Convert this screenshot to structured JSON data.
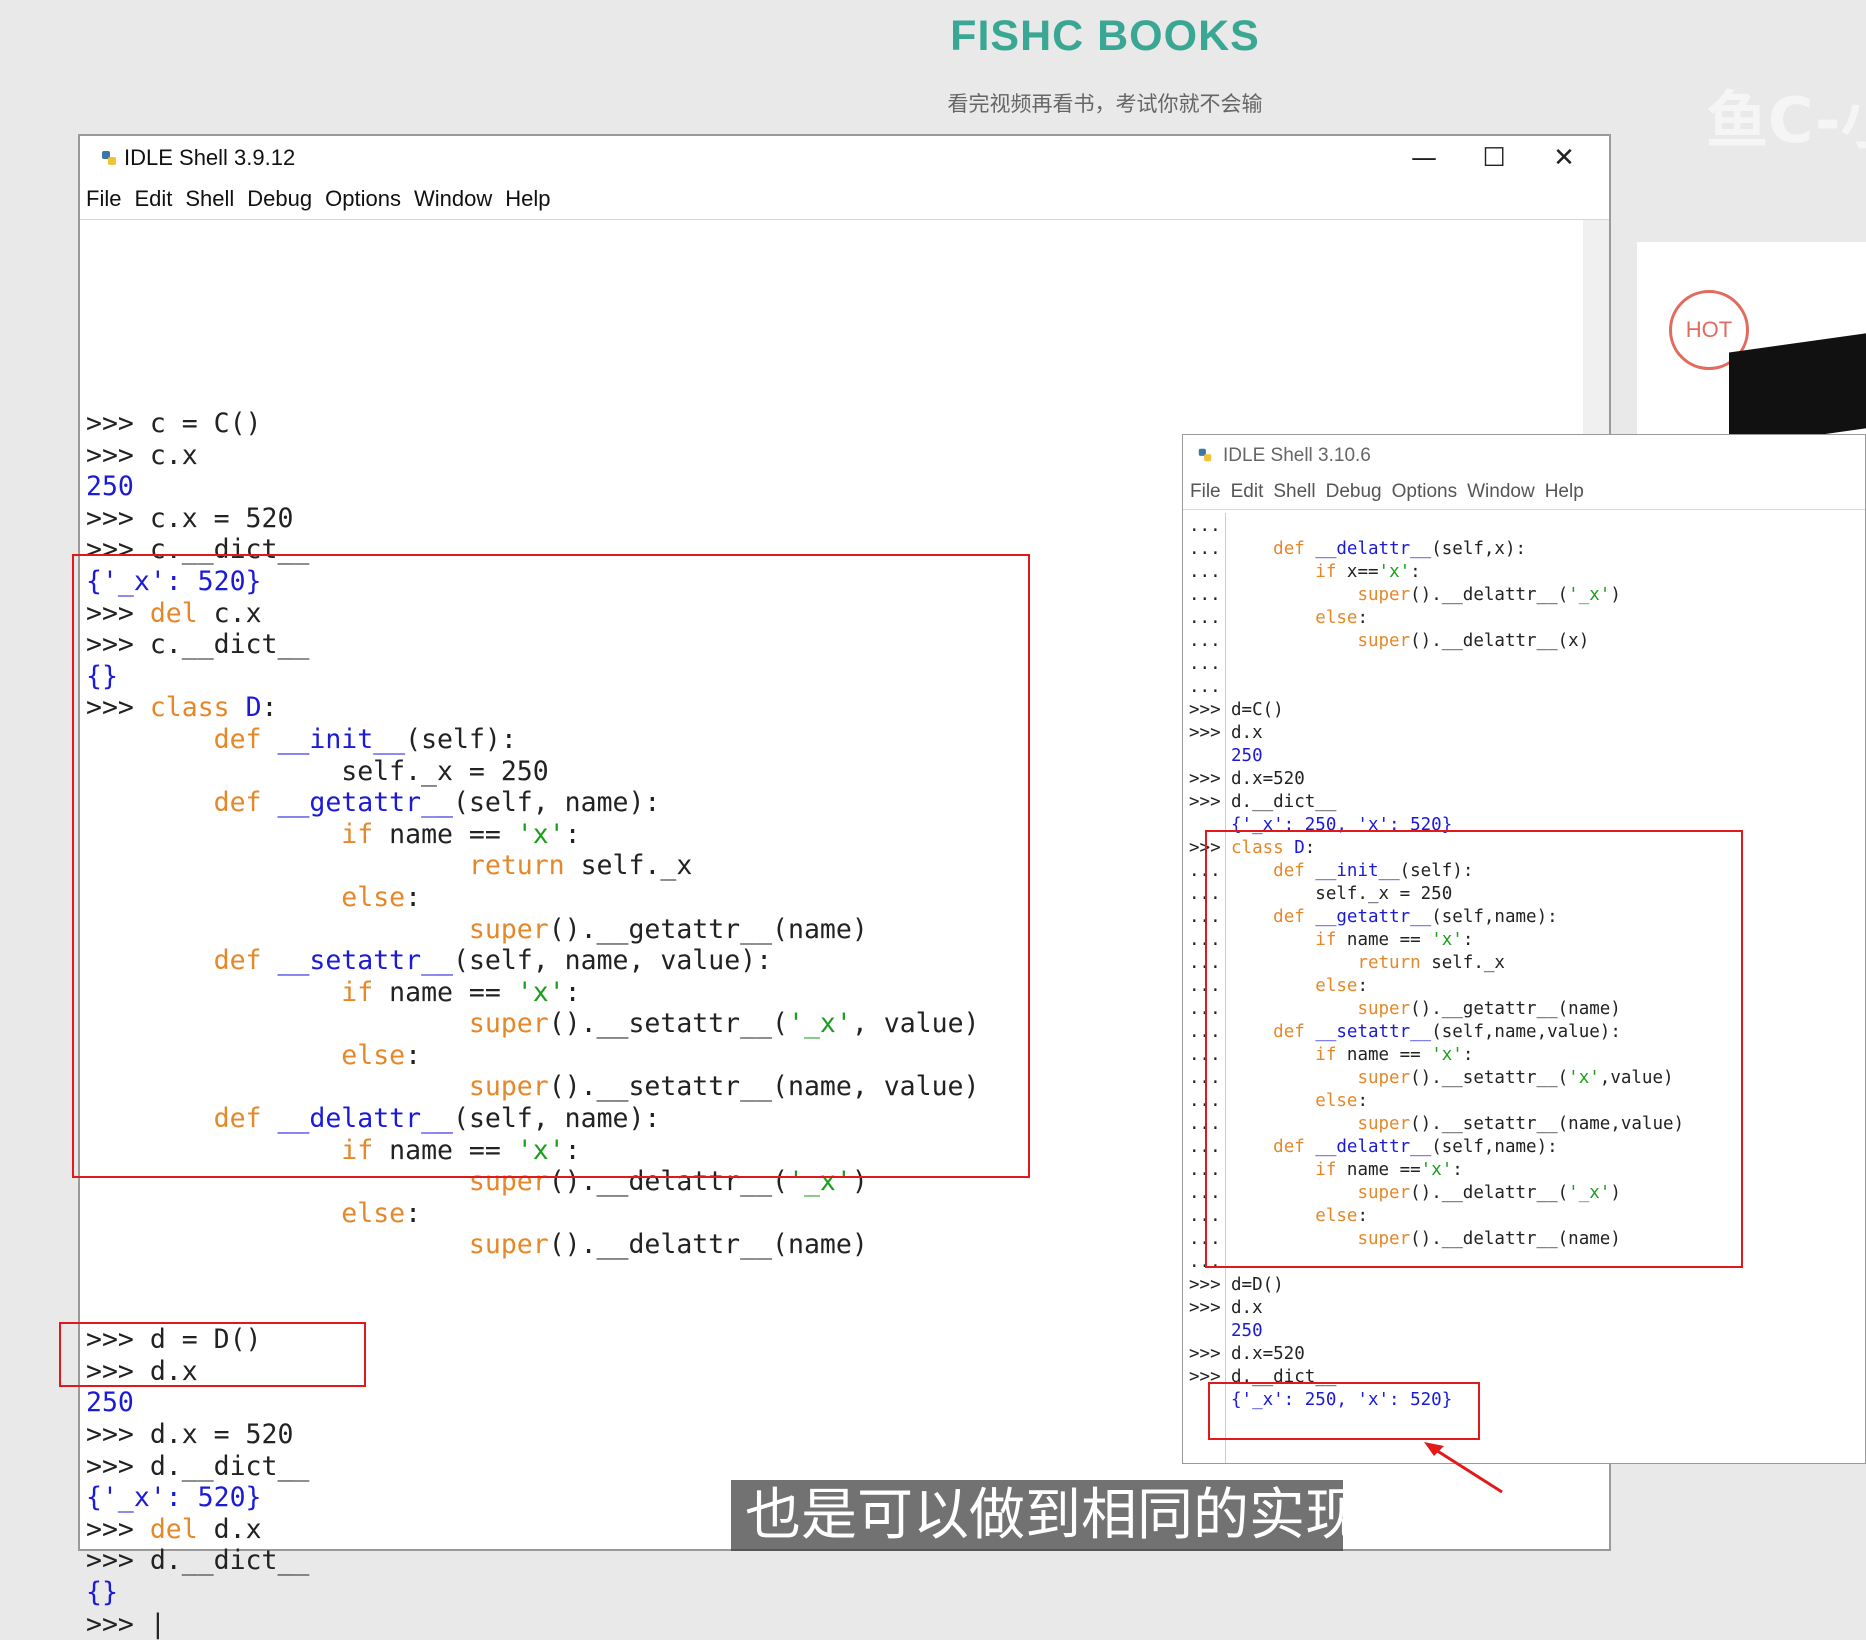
{
  "header": {
    "brand": "FISHC BOOKS",
    "slogan": "看完视频再看书，考试你就不会输",
    "watermark": "鱼C-小"
  },
  "promo": {
    "badge": "HOT"
  },
  "shell_left": {
    "title": "IDLE Shell 3.9.12",
    "menu": [
      "File",
      "Edit",
      "Shell",
      "Debug",
      "Options",
      "Window",
      "Help"
    ],
    "controls": {
      "minimize": "—",
      "maximize": "☐",
      "close": "✕"
    },
    "lines": [
      [
        [
          "p",
          ">>> "
        ],
        [
          "n",
          "c = C()"
        ]
      ],
      [
        [
          "p",
          ">>> "
        ],
        [
          "n",
          "c.x"
        ]
      ],
      [
        [
          "o",
          "250"
        ]
      ],
      [
        [
          "p",
          ">>> "
        ],
        [
          "n",
          "c.x = 520"
        ]
      ],
      [
        [
          "p",
          ">>> "
        ],
        [
          "n",
          "c.__dict__"
        ]
      ],
      [
        [
          "o",
          "{'_x': 520}"
        ]
      ],
      [
        [
          "p",
          ">>> "
        ],
        [
          "k",
          "del"
        ],
        [
          "n",
          " c.x"
        ]
      ],
      [
        [
          "p",
          ">>> "
        ],
        [
          "n",
          "c.__dict__"
        ]
      ],
      [
        [
          "o",
          "{}"
        ]
      ],
      [
        [
          "p",
          ">>> "
        ],
        [
          "k",
          "class"
        ],
        [
          "n",
          " "
        ],
        [
          "f",
          "D"
        ],
        [
          "n",
          ":"
        ]
      ],
      [
        [
          "n",
          "        "
        ],
        [
          "k",
          "def"
        ],
        [
          "n",
          " "
        ],
        [
          "f",
          "__init__"
        ],
        [
          "n",
          "(self):"
        ]
      ],
      [
        [
          "n",
          "                self._x = 250"
        ]
      ],
      [
        [
          "n",
          "        "
        ],
        [
          "k",
          "def"
        ],
        [
          "n",
          " "
        ],
        [
          "f",
          "__getattr__"
        ],
        [
          "n",
          "(self, name):"
        ]
      ],
      [
        [
          "n",
          "                "
        ],
        [
          "k",
          "if"
        ],
        [
          "n",
          " name == "
        ],
        [
          "s",
          "'x'"
        ],
        [
          "n",
          ":"
        ]
      ],
      [
        [
          "n",
          "                        "
        ],
        [
          "k",
          "return"
        ],
        [
          "n",
          " self._x"
        ]
      ],
      [
        [
          "n",
          "                "
        ],
        [
          "k",
          "else"
        ],
        [
          "n",
          ":"
        ]
      ],
      [
        [
          "n",
          "                        "
        ],
        [
          "k",
          "super"
        ],
        [
          "n",
          "().__getattr__(name)"
        ]
      ],
      [
        [
          "n",
          "        "
        ],
        [
          "k",
          "def"
        ],
        [
          "n",
          " "
        ],
        [
          "f",
          "__setattr__"
        ],
        [
          "n",
          "(self, name, value):"
        ]
      ],
      [
        [
          "n",
          "                "
        ],
        [
          "k",
          "if"
        ],
        [
          "n",
          " name == "
        ],
        [
          "s",
          "'x'"
        ],
        [
          "n",
          ":"
        ]
      ],
      [
        [
          "n",
          "                        "
        ],
        [
          "k",
          "super"
        ],
        [
          "n",
          "().__setattr__("
        ],
        [
          "s",
          "'_x'"
        ],
        [
          "n",
          ", value)"
        ]
      ],
      [
        [
          "n",
          "                "
        ],
        [
          "k",
          "else"
        ],
        [
          "n",
          ":"
        ]
      ],
      [
        [
          "n",
          "                        "
        ],
        [
          "k",
          "super"
        ],
        [
          "n",
          "().__setattr__(name, value)"
        ]
      ],
      [
        [
          "n",
          "        "
        ],
        [
          "k",
          "def"
        ],
        [
          "n",
          " "
        ],
        [
          "f",
          "__delattr__"
        ],
        [
          "n",
          "(self, name):"
        ]
      ],
      [
        [
          "n",
          "                "
        ],
        [
          "k",
          "if"
        ],
        [
          "n",
          " name == "
        ],
        [
          "s",
          "'x'"
        ],
        [
          "n",
          ":"
        ]
      ],
      [
        [
          "n",
          "                        "
        ],
        [
          "k",
          "super"
        ],
        [
          "n",
          "().__delattr__("
        ],
        [
          "s",
          "'_x'"
        ],
        [
          "n",
          ")"
        ]
      ],
      [
        [
          "n",
          "                "
        ],
        [
          "k",
          "else"
        ],
        [
          "n",
          ":"
        ]
      ],
      [
        [
          "n",
          "                        "
        ],
        [
          "k",
          "super"
        ],
        [
          "n",
          "().__delattr__(name)"
        ]
      ],
      [
        [
          "n",
          ""
        ]
      ],
      [
        [
          "n",
          ""
        ]
      ],
      [
        [
          "p",
          ">>> "
        ],
        [
          "n",
          "d = D()"
        ]
      ],
      [
        [
          "p",
          ">>> "
        ],
        [
          "n",
          "d.x"
        ]
      ],
      [
        [
          "o",
          "250"
        ]
      ],
      [
        [
          "p",
          ">>> "
        ],
        [
          "n",
          "d.x = 520"
        ]
      ],
      [
        [
          "p",
          ">>> "
        ],
        [
          "n",
          "d.__dict__"
        ]
      ],
      [
        [
          "o",
          "{'_x': 520}"
        ]
      ],
      [
        [
          "p",
          ">>> "
        ],
        [
          "k",
          "del"
        ],
        [
          "n",
          " d.x"
        ]
      ],
      [
        [
          "p",
          ">>> "
        ],
        [
          "n",
          "d.__dict__"
        ]
      ],
      [
        [
          "o",
          "{}"
        ]
      ],
      [
        [
          "p",
          ">>> "
        ],
        [
          "n",
          "|"
        ]
      ]
    ]
  },
  "shell_right": {
    "title": "IDLE Shell 3.10.6",
    "menu": [
      "File",
      "Edit",
      "Shell",
      "Debug",
      "Options",
      "Window",
      "Help"
    ],
    "gutter": [
      "...",
      "...",
      "...",
      "...",
      "...",
      "...",
      "...",
      "...",
      ">>>",
      ">>>",
      "",
      ">>>",
      ">>>",
      "",
      ">>>",
      "...",
      "...",
      "...",
      "...",
      "...",
      "...",
      "...",
      "...",
      "...",
      "...",
      "...",
      "...",
      "...",
      "...",
      "...",
      "...",
      "...",
      "...",
      ">>>",
      ">>>",
      "",
      ">>>",
      ">>>"
    ],
    "lines": [
      [
        [
          "n",
          ""
        ]
      ],
      [
        [
          "n",
          "    "
        ],
        [
          "k",
          "def"
        ],
        [
          "n",
          " "
        ],
        [
          "f",
          "__delattr__"
        ],
        [
          "n",
          "(self,x):"
        ]
      ],
      [
        [
          "n",
          "        "
        ],
        [
          "k",
          "if"
        ],
        [
          "n",
          " x=="
        ],
        [
          "s",
          "'x'"
        ],
        [
          "n",
          ":"
        ]
      ],
      [
        [
          "n",
          "            "
        ],
        [
          "k",
          "super"
        ],
        [
          "n",
          "().__delattr__("
        ],
        [
          "s",
          "'_x'"
        ],
        [
          "n",
          ")"
        ]
      ],
      [
        [
          "n",
          "        "
        ],
        [
          "k",
          "else"
        ],
        [
          "n",
          ":"
        ]
      ],
      [
        [
          "n",
          "            "
        ],
        [
          "k",
          "super"
        ],
        [
          "n",
          "().__delattr__(x)"
        ]
      ],
      [
        [
          "n",
          ""
        ]
      ],
      [
        [
          "n",
          ""
        ]
      ],
      [
        [
          "n",
          "d=C()"
        ]
      ],
      [
        [
          "n",
          "d.x"
        ]
      ],
      [
        [
          "o",
          "250"
        ]
      ],
      [
        [
          "n",
          "d.x=520"
        ]
      ],
      [
        [
          "n",
          "d.__dict__"
        ]
      ],
      [
        [
          "o",
          "{'_x': 250, 'x': 520}"
        ]
      ],
      [
        [
          "k",
          "class"
        ],
        [
          "n",
          " "
        ],
        [
          "f",
          "D"
        ],
        [
          "n",
          ":"
        ]
      ],
      [
        [
          "n",
          "    "
        ],
        [
          "k",
          "def"
        ],
        [
          "n",
          " "
        ],
        [
          "f",
          "__init__"
        ],
        [
          "n",
          "(self):"
        ]
      ],
      [
        [
          "n",
          "        self._x = 250"
        ]
      ],
      [
        [
          "n",
          "    "
        ],
        [
          "k",
          "def"
        ],
        [
          "n",
          " "
        ],
        [
          "f",
          "__getattr__"
        ],
        [
          "n",
          "(self,name):"
        ]
      ],
      [
        [
          "n",
          "        "
        ],
        [
          "k",
          "if"
        ],
        [
          "n",
          " name == "
        ],
        [
          "s",
          "'x'"
        ],
        [
          "n",
          ":"
        ]
      ],
      [
        [
          "n",
          "            "
        ],
        [
          "k",
          "return"
        ],
        [
          "n",
          " self._x"
        ]
      ],
      [
        [
          "n",
          "        "
        ],
        [
          "k",
          "else"
        ],
        [
          "n",
          ":"
        ]
      ],
      [
        [
          "n",
          "            "
        ],
        [
          "k",
          "super"
        ],
        [
          "n",
          "().__getattr__(name)"
        ]
      ],
      [
        [
          "n",
          "    "
        ],
        [
          "k",
          "def"
        ],
        [
          "n",
          " "
        ],
        [
          "f",
          "__setattr__"
        ],
        [
          "n",
          "(self,name,value):"
        ]
      ],
      [
        [
          "n",
          "        "
        ],
        [
          "k",
          "if"
        ],
        [
          "n",
          " name == "
        ],
        [
          "s",
          "'x'"
        ],
        [
          "n",
          ":"
        ]
      ],
      [
        [
          "n",
          "            "
        ],
        [
          "k",
          "super"
        ],
        [
          "n",
          "().__setattr__("
        ],
        [
          "s",
          "'x'"
        ],
        [
          "n",
          ",value)"
        ]
      ],
      [
        [
          "n",
          "        "
        ],
        [
          "k",
          "else"
        ],
        [
          "n",
          ":"
        ]
      ],
      [
        [
          "n",
          "            "
        ],
        [
          "k",
          "super"
        ],
        [
          "n",
          "().__setattr__(name,value)"
        ]
      ],
      [
        [
          "n",
          "    "
        ],
        [
          "k",
          "def"
        ],
        [
          "n",
          " "
        ],
        [
          "f",
          "__delattr__"
        ],
        [
          "n",
          "(self,name):"
        ]
      ],
      [
        [
          "n",
          "        "
        ],
        [
          "k",
          "if"
        ],
        [
          "n",
          " name =="
        ],
        [
          "s",
          "'x'"
        ],
        [
          "n",
          ":"
        ]
      ],
      [
        [
          "n",
          "            "
        ],
        [
          "k",
          "super"
        ],
        [
          "n",
          "().__delattr__("
        ],
        [
          "s",
          "'_x'"
        ],
        [
          "n",
          ")"
        ]
      ],
      [
        [
          "n",
          "        "
        ],
        [
          "k",
          "else"
        ],
        [
          "n",
          ":"
        ]
      ],
      [
        [
          "n",
          "            "
        ],
        [
          "k",
          "super"
        ],
        [
          "n",
          "().__delattr__(name)"
        ]
      ],
      [
        [
          "n",
          ""
        ]
      ],
      [
        [
          "n",
          "d=D()"
        ]
      ],
      [
        [
          "n",
          "d.x"
        ]
      ],
      [
        [
          "o",
          "250"
        ]
      ],
      [
        [
          "n",
          "d.x=520"
        ]
      ],
      [
        [
          "n",
          "d.__dict__"
        ]
      ],
      [
        [
          "o",
          "{'_x': 250, 'x': 520}"
        ]
      ]
    ]
  },
  "subtitle": "也是可以做到相同的实现",
  "colors": {
    "keyword": "#e5882a",
    "function": "#1a1ad8",
    "string": "#1b9e1b",
    "output": "#1a1ad8",
    "highlight": "#e31919",
    "brand": "#3aa795"
  }
}
